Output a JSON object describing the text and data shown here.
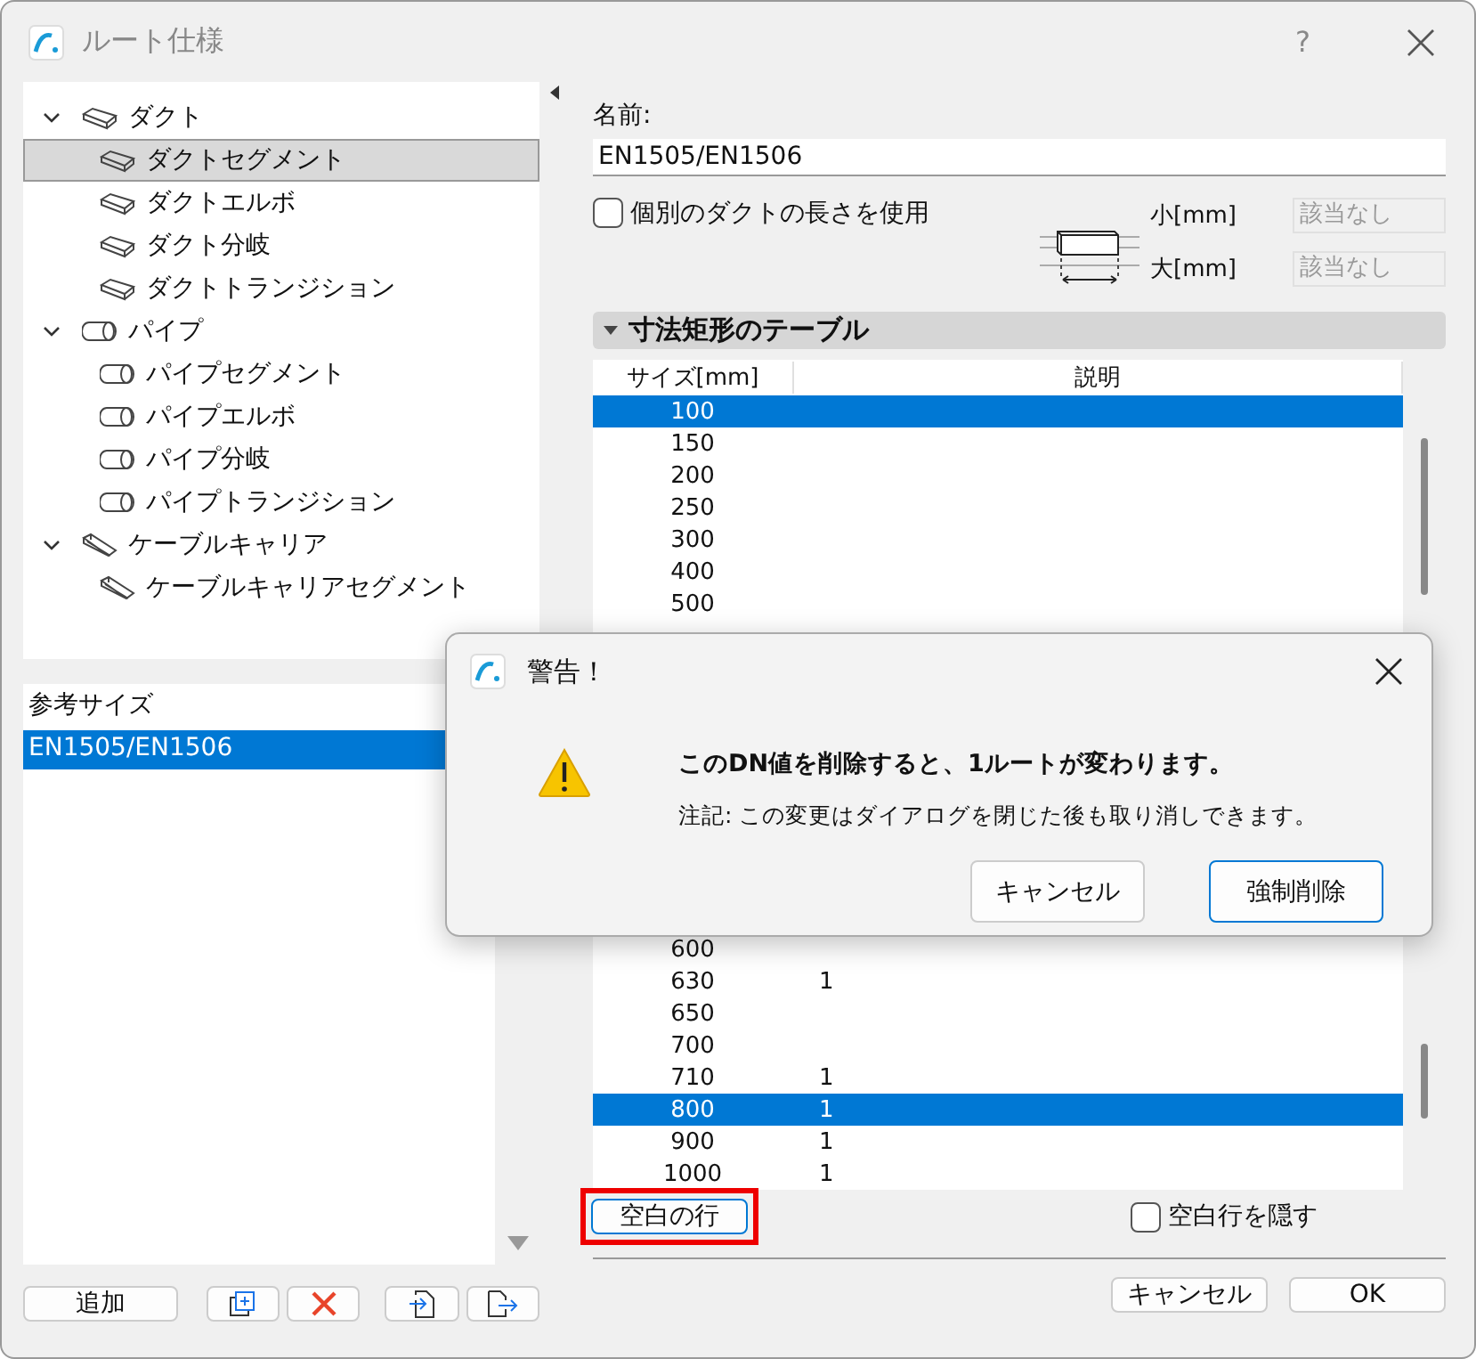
{
  "window": {
    "title": "ルート仕様",
    "help": "?"
  },
  "tree": [
    {
      "label": "ダクト",
      "kind": "duct",
      "expanded": true,
      "selected": false,
      "children": [
        {
          "label": "ダクトセグメント",
          "kind": "duct",
          "selected": true
        },
        {
          "label": "ダクトエルボ",
          "kind": "duct",
          "selected": false
        },
        {
          "label": "ダクト分岐",
          "kind": "duct",
          "selected": false
        },
        {
          "label": "ダクトトランジション",
          "kind": "duct",
          "selected": false
        }
      ]
    },
    {
      "label": "パイプ",
      "kind": "pipe",
      "expanded": true,
      "selected": false,
      "children": [
        {
          "label": "パイプセグメント",
          "kind": "pipe",
          "selected": false
        },
        {
          "label": "パイプエルボ",
          "kind": "pipe",
          "selected": false
        },
        {
          "label": "パイプ分岐",
          "kind": "pipe",
          "selected": false
        },
        {
          "label": "パイプトランジション",
          "kind": "pipe",
          "selected": false
        }
      ]
    },
    {
      "label": "ケーブルキャリア",
      "kind": "tray",
      "expanded": true,
      "selected": false,
      "children": [
        {
          "label": "ケーブルキャリアセグメント",
          "kind": "tray",
          "selected": false
        }
      ]
    }
  ],
  "reference_sizes": {
    "header": "参考サイズ",
    "items": [
      {
        "label": "EN1505/EN1506",
        "selected": true
      }
    ]
  },
  "left_buttons": [
    {
      "kind": "text",
      "label": "追加"
    },
    {
      "kind": "duplicate"
    },
    {
      "kind": "delete"
    },
    {
      "kind": "import"
    },
    {
      "kind": "export"
    }
  ],
  "name": {
    "label": "名前:",
    "value": "EN1505/EN1506"
  },
  "individual_length": {
    "label": "個別のダクトの長さを使用",
    "checked": false
  },
  "limits": [
    {
      "label": "小[mm]",
      "value": "該当なし",
      "disabled": true
    },
    {
      "label": "大[mm]",
      "value": "該当なし",
      "disabled": true
    }
  ],
  "section": {
    "title": "寸法矩形のテーブル",
    "expanded": true
  },
  "table": {
    "columns": [
      "サイズ[mm]",
      "説明"
    ],
    "rows_top": [
      {
        "size": "100",
        "selected": true
      },
      {
        "size": "150",
        "selected": false
      },
      {
        "size": "200",
        "selected": false
      },
      {
        "size": "250",
        "selected": false
      },
      {
        "size": "300",
        "selected": false
      },
      {
        "size": "400",
        "selected": false
      },
      {
        "size": "500",
        "selected": false
      }
    ],
    "rows_bottom": [
      {
        "size": "600",
        "selected": false
      },
      {
        "size": "630",
        "note": "1",
        "selected": false
      },
      {
        "size": "650",
        "selected": false
      },
      {
        "size": "700",
        "selected": false
      },
      {
        "size": "710",
        "note": "1",
        "selected": false
      },
      {
        "size": "800",
        "note": "1",
        "selected": true
      },
      {
        "size": "900",
        "note": "1",
        "selected": false
      },
      {
        "size": "1000",
        "note": "1",
        "selected": false
      }
    ]
  },
  "blank_row_button": {
    "label": "空白の行",
    "highlighted": true
  },
  "hide_blank_rows": {
    "label": "空白行を隠す",
    "checked": false
  },
  "footer_buttons": [
    "キャンセル",
    "OK"
  ],
  "dialog": {
    "title": "警告！",
    "message": "このDN値を削除すると、1ルートが変わります。",
    "note": "注記: この変更はダイアログを閉じた後も取り消しできます。",
    "buttons": [
      {
        "label": "キャンセル",
        "default": false
      },
      {
        "label": "強制削除",
        "default": true
      }
    ]
  }
}
